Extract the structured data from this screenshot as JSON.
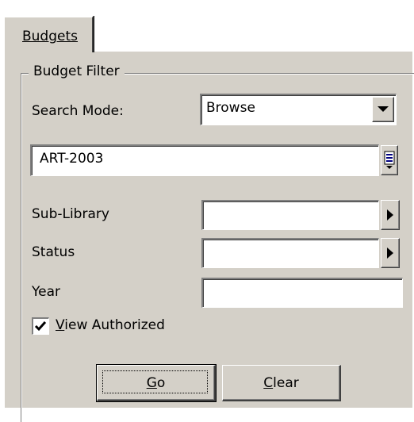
{
  "tab": {
    "label": "Budgets"
  },
  "filter": {
    "group_label": "Budget Filter",
    "search_mode": {
      "label": "Search Mode:",
      "value": "Browse"
    },
    "search_text": {
      "value": "ART-2003"
    },
    "sub_library": {
      "label": "Sub-Library",
      "value": ""
    },
    "status": {
      "label": "Status",
      "value": ""
    },
    "year": {
      "label": "Year",
      "value": ""
    },
    "view_authorized": {
      "label_mnemonic": "V",
      "label_rest": "iew Authorized",
      "checked": true
    }
  },
  "buttons": {
    "go": {
      "mnemonic": "G",
      "rest": "o"
    },
    "clear": {
      "mnemonic": "C",
      "rest": "lear"
    }
  },
  "colors": {
    "face": "#d4d0c8",
    "shadow": "#808080",
    "highlight": "#ffffff",
    "dark": "#404040"
  }
}
